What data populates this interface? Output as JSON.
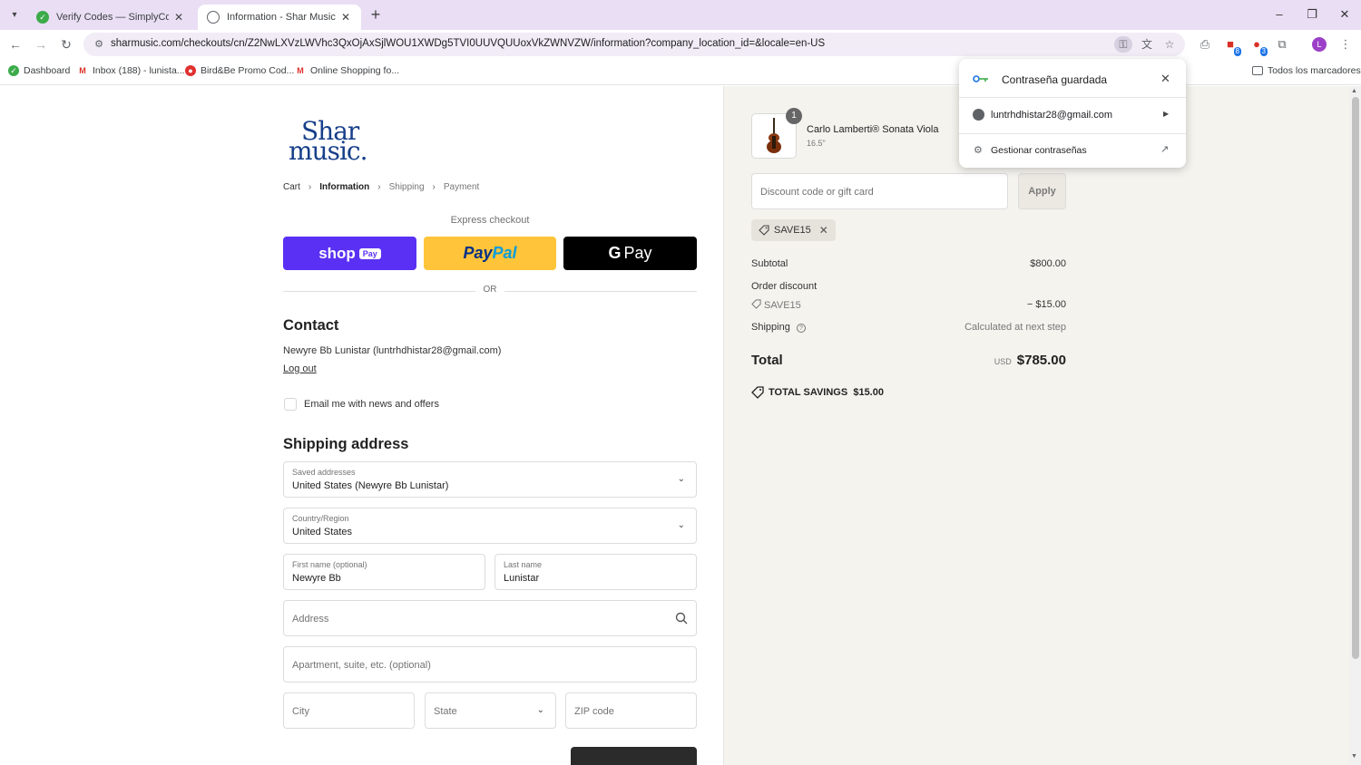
{
  "browser": {
    "tabs": [
      {
        "title": "Verify Codes — SimplyCodes",
        "active": false
      },
      {
        "title": "Information - Shar Music - Che",
        "active": true
      }
    ],
    "url": "sharmusic.com/checkouts/cn/Z2NwLXVzLWVhc3QxOjAxSjlWOU1XWDg5TVI0UUVQUUoxVkZWNVZW/information?company_location_id=&locale=en-US",
    "bookmarks": [
      {
        "label": "Dashboard"
      },
      {
        "label": "Inbox (188) - lunista..."
      },
      {
        "label": "Bird&Be Promo Cod..."
      },
      {
        "label": "Online Shopping fo..."
      }
    ],
    "all_bookmarks": "Todos los marcadores",
    "profile_initial": "L",
    "ext_badge_1": "8",
    "ext_badge_2": "3"
  },
  "password_popup": {
    "title": "Contraseña guardada",
    "account": "luntrhdhistar28@gmail.com",
    "manage": "Gestionar contraseñas"
  },
  "checkout": {
    "logo_line1": "Shar",
    "logo_line2": "music.",
    "breadcrumb": [
      "Cart",
      "Information",
      "Shipping",
      "Payment"
    ],
    "express_label": "Express checkout",
    "shop_pay": {
      "shop": "shop",
      "pay": "Pay"
    },
    "paypal": {
      "pay": "Pay",
      "pal": "Pal"
    },
    "gpay": {
      "g": "G",
      "pay": "Pay"
    },
    "or_text": "OR",
    "contact": {
      "heading": "Contact",
      "line": "Newyre Bb Lunistar (luntrhdhistar28@gmail.com)",
      "logout": "Log out",
      "newsletter": "Email me with news and offers"
    },
    "shipping": {
      "heading": "Shipping address",
      "saved_label": "Saved addresses",
      "saved_value": "United States (Newyre Bb Lunistar)",
      "country_label": "Country/Region",
      "country_value": "United States",
      "first_label": "First name (optional)",
      "first_value": "Newyre Bb",
      "last_label": "Last name",
      "last_value": "Lunistar",
      "address_ph": "Address",
      "apt_ph": "Apartment, suite, etc. (optional)",
      "city_ph": "City",
      "state_ph": "State",
      "zip_ph": "ZIP code"
    }
  },
  "summary": {
    "product_name": "Carlo Lamberti® Sonata Viola",
    "product_variant": "16.5\"",
    "quantity": "1",
    "discount_placeholder": "Discount code or gift card",
    "apply": "Apply",
    "applied_code": "SAVE15",
    "subtotal_label": "Subtotal",
    "subtotal_value": "$800.00",
    "order_discount_label": "Order discount",
    "discount_code": "SAVE15",
    "discount_value": "− $15.00",
    "shipping_label": "Shipping",
    "shipping_value": "Calculated at next step",
    "total_label": "Total",
    "currency": "USD",
    "total_value": "$785.00",
    "savings_label": "TOTAL SAVINGS",
    "savings_value": "$15.00"
  }
}
